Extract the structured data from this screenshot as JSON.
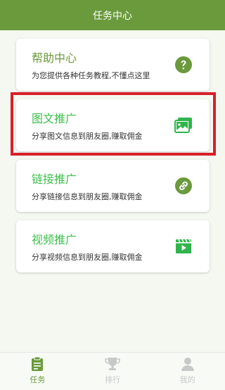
{
  "header": {
    "title": "任务中心"
  },
  "cards": [
    {
      "title": "帮助中心",
      "subtitle": "为您提供各种任务教程,不懂点这里",
      "icon": "help-icon"
    },
    {
      "title": "图文推广",
      "subtitle": "分享图文信息到朋友圈,赚取佣金",
      "icon": "image-text-icon"
    },
    {
      "title": "链接推广",
      "subtitle": "分享链接信息到朋友圈,赚取佣金",
      "icon": "link-icon"
    },
    {
      "title": "视频推广",
      "subtitle": "分享视频信息到朋友圈,赚取佣金",
      "icon": "video-icon"
    }
  ],
  "tabs": [
    {
      "label": "任务",
      "icon": "clipboard-icon",
      "active": true
    },
    {
      "label": "排行",
      "icon": "trophy-icon",
      "active": false
    },
    {
      "label": "我的",
      "icon": "user-icon",
      "active": false
    }
  ],
  "colors": {
    "header_bg": "#6a9a3c",
    "card_title_help": "#6a9a3c",
    "card_title": "#3cbf4a",
    "icon_green": "#6a9a3c",
    "icon_bright_green": "#2fb54a",
    "highlight_red": "#d8202b",
    "tab_active": "#6a9a3c",
    "tab_inactive": "#c8c8c8"
  }
}
